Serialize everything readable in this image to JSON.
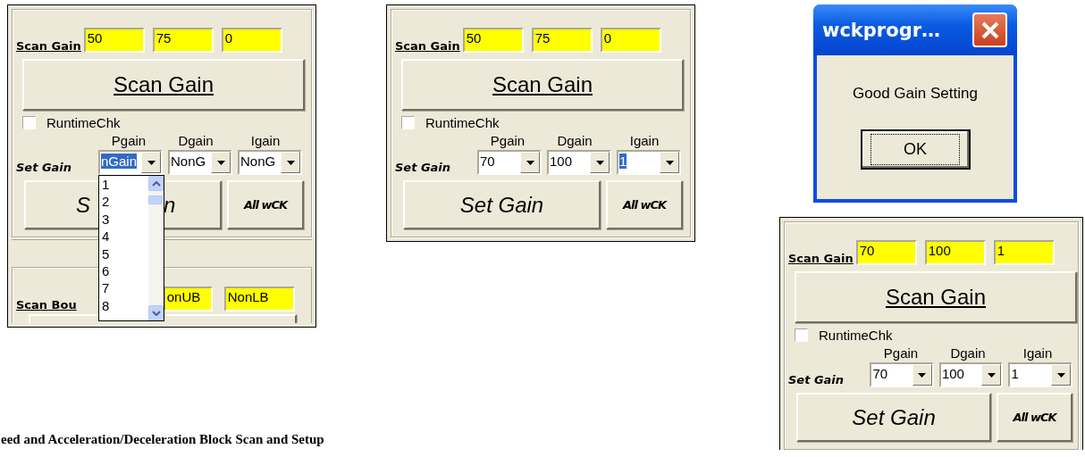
{
  "panels": [
    {
      "scan_gain": {
        "label": "Scan Gain",
        "fields": [
          "50",
          "75",
          "0"
        ]
      },
      "scan_button": "Scan Gain",
      "runtime_check": {
        "label": "RuntimeChk",
        "checked": false
      },
      "set_gain": {
        "label": "Set Gain",
        "combos": [
          {
            "label": "Pgain",
            "value": "nGain",
            "focused": true
          },
          {
            "label": "Dgain",
            "value": "NonG",
            "focused": false
          },
          {
            "label": "Igain",
            "value": "NonG",
            "focused": false
          }
        ]
      },
      "set_button": "S",
      "set_button_end": "n",
      "all_button": "All wCK",
      "dropdown": {
        "items": [
          "1",
          "2",
          "3",
          "4",
          "5",
          "6",
          "7",
          "8"
        ]
      },
      "scan_bound": {
        "label": "Scan Bou",
        "fields": [
          "onUB",
          "NonLB"
        ]
      }
    },
    {
      "scan_gain": {
        "label": "Scan Gain",
        "fields": [
          "50",
          "75",
          "0"
        ]
      },
      "scan_button": "Scan Gain",
      "runtime_check": {
        "label": "RuntimeChk",
        "checked": false
      },
      "set_gain": {
        "label": "Set Gain",
        "combos": [
          {
            "label": "Pgain",
            "value": "70",
            "focused": false
          },
          {
            "label": "Dgain",
            "value": "100",
            "focused": false
          },
          {
            "label": "Igain",
            "value": "1",
            "focused": true
          }
        ]
      },
      "set_button": "Set Gain",
      "all_button": "All wCK"
    },
    {
      "scan_gain": {
        "label": "Scan Gain",
        "fields": [
          "70",
          "100",
          "1"
        ]
      },
      "scan_button": "Scan Gain",
      "runtime_check": {
        "label": "RuntimeChk",
        "checked": false
      },
      "set_gain": {
        "label": "Set Gain",
        "combos": [
          {
            "label": "Pgain",
            "value": "70",
            "focused": false
          },
          {
            "label": "Dgain",
            "value": "100",
            "focused": false
          },
          {
            "label": "Igain",
            "value": "1",
            "focused": false
          }
        ]
      },
      "set_button": "Set Gain",
      "all_button": "All wCK"
    }
  ],
  "dialog": {
    "title": "wckprogr…",
    "message": "Good Gain Setting",
    "button": "OK"
  },
  "caption": "eed and Acceleration/Deceleration Block Scan and Setup"
}
